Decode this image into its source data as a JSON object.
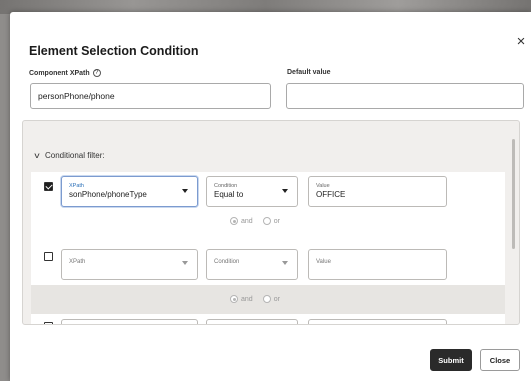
{
  "dialog": {
    "title": "Element Selection Condition",
    "close_glyph": "×"
  },
  "component_xpath": {
    "label": "Component XPath",
    "help_icon": "?",
    "value": "personPhone/phone"
  },
  "default_value": {
    "label": "Default value",
    "value": ""
  },
  "conditional_filter": {
    "label": "Conditional filter:",
    "expander_glyph": "v",
    "rows": [
      {
        "checked": true,
        "xpath": {
          "label": "XPath",
          "value": "sonPhone/phoneType"
        },
        "condition": {
          "label": "Condition",
          "value": "Equal to"
        },
        "value": {
          "label": "Value",
          "value": "OFFICE"
        },
        "join": {
          "and_label": "and",
          "or_label": "or",
          "selected": "and"
        }
      },
      {
        "checked": false,
        "xpath": {
          "placeholder": "XPath"
        },
        "condition": {
          "placeholder": "Condition"
        },
        "value": {
          "placeholder": "Value"
        },
        "join": {
          "and_label": "and",
          "or_label": "or",
          "selected": "and"
        }
      },
      {
        "checked": false
      }
    ]
  },
  "footer": {
    "submit_label": "Submit",
    "close_label": "Close"
  },
  "colors": {
    "primary_button": "#2a2a2a",
    "active_field_border": "#7c9bcf",
    "xpath_label_blue": "#2a6fb8",
    "filter_panel_bg": "#f1efed"
  }
}
